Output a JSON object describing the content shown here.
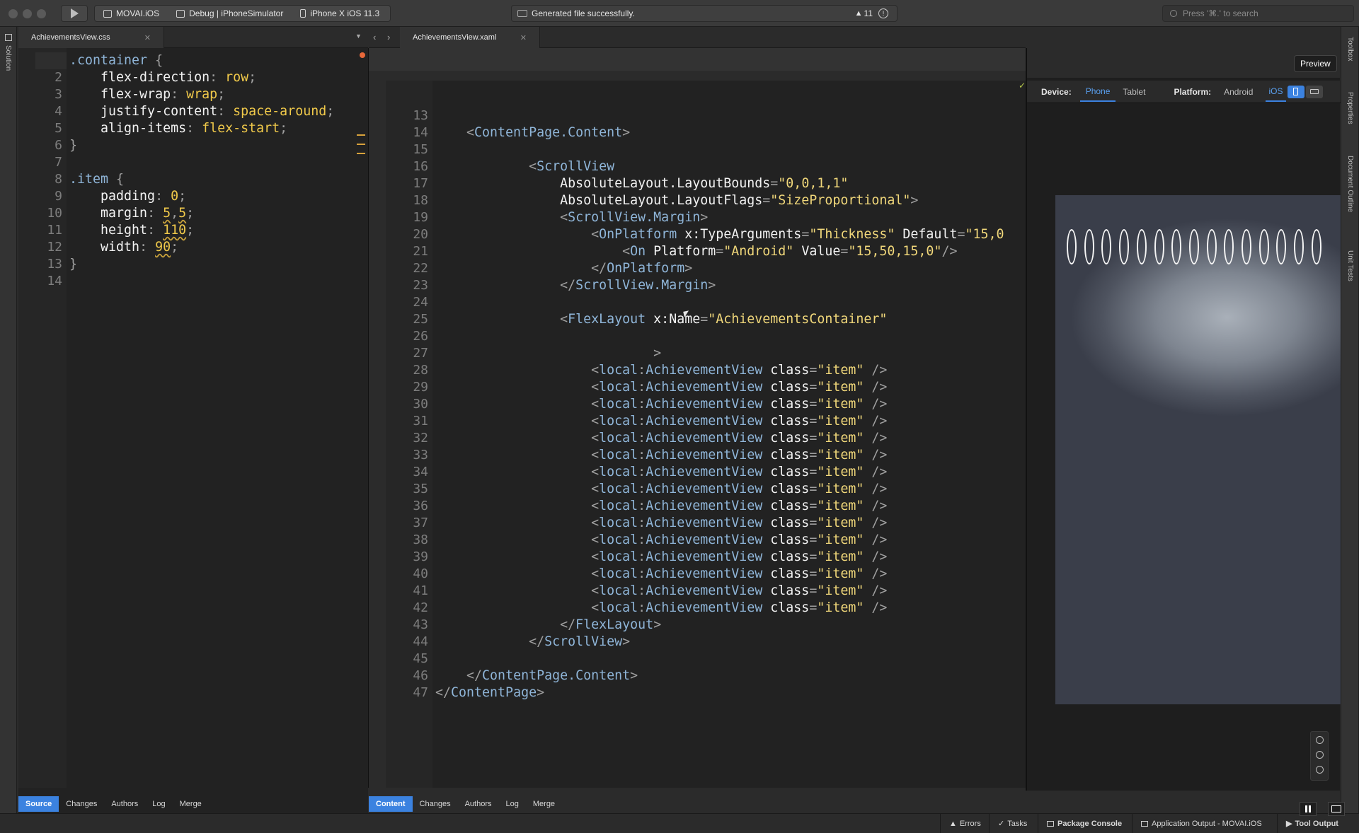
{
  "titlebar": {
    "project": "MOVAI.iOS",
    "config": "Debug | iPhoneSimulator",
    "device": "iPhone X iOS 11.3",
    "status": "Generated file successfully.",
    "warnings_count": "11",
    "search_placeholder": "Press '⌘.' to search"
  },
  "left_sidebar": {
    "label": "Solution"
  },
  "right_sidebar": {
    "items": [
      "Toolbox",
      "Properties",
      "Document Outline",
      "Unit Tests"
    ]
  },
  "css_editor": {
    "tab_label": "AchievementsView.css",
    "lines": [
      {
        "n": "1",
        "tokens": [
          [
            ".container",
            "sel"
          ],
          [
            " ",
            "pun"
          ],
          [
            "{",
            "pun"
          ]
        ]
      },
      {
        "n": "2",
        "tokens": [
          [
            "    flex-direction",
            "prop"
          ],
          [
            ": ",
            "pun"
          ],
          [
            "row",
            "val"
          ],
          [
            ";",
            "pun"
          ]
        ]
      },
      {
        "n": "3",
        "tokens": [
          [
            "    flex-wrap",
            "prop"
          ],
          [
            ": ",
            "pun"
          ],
          [
            "wrap",
            "val"
          ],
          [
            ";",
            "pun"
          ]
        ]
      },
      {
        "n": "4",
        "tokens": [
          [
            "    justify-content",
            "prop"
          ],
          [
            ": ",
            "pun"
          ],
          [
            "space-around",
            "val"
          ],
          [
            ";",
            "pun"
          ]
        ]
      },
      {
        "n": "5",
        "tokens": [
          [
            "    align-items",
            "prop"
          ],
          [
            ": ",
            "pun"
          ],
          [
            "flex-start",
            "val"
          ],
          [
            ";",
            "pun"
          ]
        ]
      },
      {
        "n": "6",
        "tokens": [
          [
            "}",
            "pun"
          ]
        ]
      },
      {
        "n": "7",
        "tokens": []
      },
      {
        "n": "8",
        "tokens": [
          [
            ".item",
            "sel"
          ],
          [
            " {",
            "pun"
          ]
        ]
      },
      {
        "n": "9",
        "tokens": [
          [
            "    padding",
            "prop"
          ],
          [
            ": ",
            "pun"
          ],
          [
            "0",
            "val"
          ],
          [
            ";",
            "pun"
          ]
        ]
      },
      {
        "n": "10",
        "tokens": [
          [
            "    margin",
            "prop"
          ],
          [
            ": ",
            "pun"
          ],
          [
            "5",
            "num"
          ],
          [
            ",",
            "pun"
          ],
          [
            "5",
            "num"
          ],
          [
            ";",
            "pun"
          ]
        ]
      },
      {
        "n": "11",
        "tokens": [
          [
            "    height",
            "prop"
          ],
          [
            ": ",
            "pun"
          ],
          [
            "110",
            "num"
          ],
          [
            ";",
            "pun"
          ]
        ]
      },
      {
        "n": "12",
        "tokens": [
          [
            "    width",
            "prop"
          ],
          [
            ": ",
            "pun"
          ],
          [
            "90",
            "num"
          ],
          [
            ";",
            "pun"
          ]
        ]
      },
      {
        "n": "13",
        "tokens": [
          [
            "}",
            "pun"
          ]
        ]
      },
      {
        "n": "14",
        "tokens": []
      }
    ],
    "bottom_tabs": [
      "Source",
      "Changes",
      "Authors",
      "Log",
      "Merge"
    ],
    "active_bottom_tab": "Source"
  },
  "xaml_editor": {
    "tab_label": "AchievementsView.xaml",
    "lines": [
      {
        "n": "13",
        "tokens": []
      },
      {
        "n": "14",
        "tokens": [
          [
            "    <",
            "pun"
          ],
          [
            "ContentPage.Content",
            "tag"
          ],
          [
            ">",
            "pun"
          ]
        ]
      },
      {
        "n": "15",
        "tokens": []
      },
      {
        "n": "16",
        "tokens": [
          [
            "            <",
            "pun"
          ],
          [
            "ScrollView",
            "tag"
          ]
        ]
      },
      {
        "n": "17",
        "tokens": [
          [
            "                AbsoluteLayout.LayoutBounds",
            "attr"
          ],
          [
            "=",
            "pun"
          ],
          [
            "\"0,0,1,1\"",
            "str"
          ]
        ]
      },
      {
        "n": "18",
        "tokens": [
          [
            "                AbsoluteLayout.LayoutFlags",
            "attr"
          ],
          [
            "=",
            "pun"
          ],
          [
            "\"SizeProportional\"",
            "str"
          ],
          [
            ">",
            "pun"
          ]
        ]
      },
      {
        "n": "19",
        "tokens": [
          [
            "                <",
            "pun"
          ],
          [
            "ScrollView.Margin",
            "tag"
          ],
          [
            ">",
            "pun"
          ]
        ]
      },
      {
        "n": "20",
        "tokens": [
          [
            "                    <",
            "pun"
          ],
          [
            "OnPlatform",
            "tag"
          ],
          [
            " x:TypeArguments",
            "attr"
          ],
          [
            "=",
            "pun"
          ],
          [
            "\"Thickness\"",
            "str"
          ],
          [
            " Default",
            "attr"
          ],
          [
            "=",
            "pun"
          ],
          [
            "\"15,0",
            "str"
          ]
        ]
      },
      {
        "n": "21",
        "tokens": [
          [
            "                        <",
            "pun"
          ],
          [
            "On",
            "tag"
          ],
          [
            " Platform",
            "attr"
          ],
          [
            "=",
            "pun"
          ],
          [
            "\"Android\"",
            "str"
          ],
          [
            " Value",
            "attr"
          ],
          [
            "=",
            "pun"
          ],
          [
            "\"15,50,15,0\"",
            "str"
          ],
          [
            "/>",
            "pun"
          ]
        ]
      },
      {
        "n": "22",
        "tokens": [
          [
            "                    </",
            "pun"
          ],
          [
            "OnPlatform",
            "tag"
          ],
          [
            ">",
            "pun"
          ]
        ]
      },
      {
        "n": "23",
        "tokens": [
          [
            "                </",
            "pun"
          ],
          [
            "ScrollView.Margin",
            "tag"
          ],
          [
            ">",
            "pun"
          ]
        ]
      },
      {
        "n": "24",
        "tokens": []
      },
      {
        "n": "25",
        "tokens": [
          [
            "                <",
            "pun"
          ],
          [
            "FlexLayout",
            "tag"
          ],
          [
            " x:Name",
            "attr"
          ],
          [
            "=",
            "pun"
          ],
          [
            "\"AchievementsContainer\"",
            "str"
          ]
        ]
      },
      {
        "n": "26",
        "tokens": []
      },
      {
        "n": "27",
        "tokens": [
          [
            "                            >",
            "pun"
          ]
        ]
      },
      {
        "n": "28",
        "tokens": [
          [
            "                    <",
            "pun"
          ],
          [
            "local",
            "tag"
          ],
          [
            ":",
            "pun"
          ],
          [
            "AchievementView",
            "tag"
          ],
          [
            " class",
            "attr"
          ],
          [
            "=",
            "pun"
          ],
          [
            "\"item\"",
            "str"
          ],
          [
            " />",
            "pun"
          ]
        ]
      },
      {
        "n": "29",
        "tokens": [
          [
            "                    <",
            "pun"
          ],
          [
            "local",
            "tag"
          ],
          [
            ":",
            "pun"
          ],
          [
            "AchievementView",
            "tag"
          ],
          [
            " class",
            "attr"
          ],
          [
            "=",
            "pun"
          ],
          [
            "\"item\"",
            "str"
          ],
          [
            " />",
            "pun"
          ]
        ]
      },
      {
        "n": "30",
        "tokens": [
          [
            "                    <",
            "pun"
          ],
          [
            "local",
            "tag"
          ],
          [
            ":",
            "pun"
          ],
          [
            "AchievementView",
            "tag"
          ],
          [
            " class",
            "attr"
          ],
          [
            "=",
            "pun"
          ],
          [
            "\"item\"",
            "str"
          ],
          [
            " />",
            "pun"
          ]
        ]
      },
      {
        "n": "31",
        "tokens": [
          [
            "                    <",
            "pun"
          ],
          [
            "local",
            "tag"
          ],
          [
            ":",
            "pun"
          ],
          [
            "AchievementView",
            "tag"
          ],
          [
            " class",
            "attr"
          ],
          [
            "=",
            "pun"
          ],
          [
            "\"item\"",
            "str"
          ],
          [
            " />",
            "pun"
          ]
        ]
      },
      {
        "n": "32",
        "tokens": [
          [
            "                    <",
            "pun"
          ],
          [
            "local",
            "tag"
          ],
          [
            ":",
            "pun"
          ],
          [
            "AchievementView",
            "tag"
          ],
          [
            " class",
            "attr"
          ],
          [
            "=",
            "pun"
          ],
          [
            "\"item\"",
            "str"
          ],
          [
            " />",
            "pun"
          ]
        ]
      },
      {
        "n": "33",
        "tokens": [
          [
            "                    <",
            "pun"
          ],
          [
            "local",
            "tag"
          ],
          [
            ":",
            "pun"
          ],
          [
            "AchievementView",
            "tag"
          ],
          [
            " class",
            "attr"
          ],
          [
            "=",
            "pun"
          ],
          [
            "\"item\"",
            "str"
          ],
          [
            " />",
            "pun"
          ]
        ]
      },
      {
        "n": "34",
        "tokens": [
          [
            "                    <",
            "pun"
          ],
          [
            "local",
            "tag"
          ],
          [
            ":",
            "pun"
          ],
          [
            "AchievementView",
            "tag"
          ],
          [
            " class",
            "attr"
          ],
          [
            "=",
            "pun"
          ],
          [
            "\"item\"",
            "str"
          ],
          [
            " />",
            "pun"
          ]
        ]
      },
      {
        "n": "35",
        "tokens": [
          [
            "                    <",
            "pun"
          ],
          [
            "local",
            "tag"
          ],
          [
            ":",
            "pun"
          ],
          [
            "AchievementView",
            "tag"
          ],
          [
            " class",
            "attr"
          ],
          [
            "=",
            "pun"
          ],
          [
            "\"item\"",
            "str"
          ],
          [
            " />",
            "pun"
          ]
        ]
      },
      {
        "n": "36",
        "tokens": [
          [
            "                    <",
            "pun"
          ],
          [
            "local",
            "tag"
          ],
          [
            ":",
            "pun"
          ],
          [
            "AchievementView",
            "tag"
          ],
          [
            " class",
            "attr"
          ],
          [
            "=",
            "pun"
          ],
          [
            "\"item\"",
            "str"
          ],
          [
            " />",
            "pun"
          ]
        ]
      },
      {
        "n": "37",
        "tokens": [
          [
            "                    <",
            "pun"
          ],
          [
            "local",
            "tag"
          ],
          [
            ":",
            "pun"
          ],
          [
            "AchievementView",
            "tag"
          ],
          [
            " class",
            "attr"
          ],
          [
            "=",
            "pun"
          ],
          [
            "\"item\"",
            "str"
          ],
          [
            " />",
            "pun"
          ]
        ]
      },
      {
        "n": "38",
        "tokens": [
          [
            "                    <",
            "pun"
          ],
          [
            "local",
            "tag"
          ],
          [
            ":",
            "pun"
          ],
          [
            "AchievementView",
            "tag"
          ],
          [
            " class",
            "attr"
          ],
          [
            "=",
            "pun"
          ],
          [
            "\"item\"",
            "str"
          ],
          [
            " />",
            "pun"
          ]
        ]
      },
      {
        "n": "39",
        "tokens": [
          [
            "                    <",
            "pun"
          ],
          [
            "local",
            "tag"
          ],
          [
            ":",
            "pun"
          ],
          [
            "AchievementView",
            "tag"
          ],
          [
            " class",
            "attr"
          ],
          [
            "=",
            "pun"
          ],
          [
            "\"item\"",
            "str"
          ],
          [
            " />",
            "pun"
          ]
        ]
      },
      {
        "n": "40",
        "tokens": [
          [
            "                    <",
            "pun"
          ],
          [
            "local",
            "tag"
          ],
          [
            ":",
            "pun"
          ],
          [
            "AchievementView",
            "tag"
          ],
          [
            " class",
            "attr"
          ],
          [
            "=",
            "pun"
          ],
          [
            "\"item\"",
            "str"
          ],
          [
            " />",
            "pun"
          ]
        ]
      },
      {
        "n": "41",
        "tokens": [
          [
            "                    <",
            "pun"
          ],
          [
            "local",
            "tag"
          ],
          [
            ":",
            "pun"
          ],
          [
            "AchievementView",
            "tag"
          ],
          [
            " class",
            "attr"
          ],
          [
            "=",
            "pun"
          ],
          [
            "\"item\"",
            "str"
          ],
          [
            " />",
            "pun"
          ]
        ]
      },
      {
        "n": "42",
        "tokens": [
          [
            "                    <",
            "pun"
          ],
          [
            "local",
            "tag"
          ],
          [
            ":",
            "pun"
          ],
          [
            "AchievementView",
            "tag"
          ],
          [
            " class",
            "attr"
          ],
          [
            "=",
            "pun"
          ],
          [
            "\"item\"",
            "str"
          ],
          [
            " />",
            "pun"
          ]
        ]
      },
      {
        "n": "43",
        "tokens": [
          [
            "                </",
            "pun"
          ],
          [
            "FlexLayout",
            "tag"
          ],
          [
            ">",
            "pun"
          ]
        ]
      },
      {
        "n": "44",
        "tokens": [
          [
            "            </",
            "pun"
          ],
          [
            "ScrollView",
            "tag"
          ],
          [
            ">",
            "pun"
          ]
        ]
      },
      {
        "n": "45",
        "tokens": []
      },
      {
        "n": "46",
        "tokens": [
          [
            "    </",
            "pun"
          ],
          [
            "ContentPage.Content",
            "tag"
          ],
          [
            ">",
            "pun"
          ]
        ]
      },
      {
        "n": "47",
        "tokens": [
          [
            "</",
            "pun"
          ],
          [
            "ContentPage",
            "tag"
          ],
          [
            ">",
            "pun"
          ]
        ]
      }
    ],
    "bottom_tabs": [
      "Content",
      "Changes",
      "Authors",
      "Log",
      "Merge"
    ],
    "active_bottom_tab": "Content"
  },
  "preview": {
    "button_label": "Preview",
    "device_label": "Device:",
    "device_options": [
      "Phone",
      "Tablet"
    ],
    "selected_device": "Phone",
    "platform_label": "Platform:",
    "platform_options": [
      "Android",
      "iOS"
    ],
    "selected_platform": "iOS",
    "achievement_count": 15
  },
  "statusbar": {
    "errors": "Errors",
    "tasks": "Tasks",
    "package_console": "Package Console",
    "app_output": "Application Output - MOVAI.iOS",
    "tool_output": "Tool Output"
  },
  "colors": {
    "accent": "#3b82e0",
    "tag": "#8fb5d8",
    "string": "#f0d77a",
    "value": "#f0c94a",
    "editor_bg": "#222222"
  }
}
